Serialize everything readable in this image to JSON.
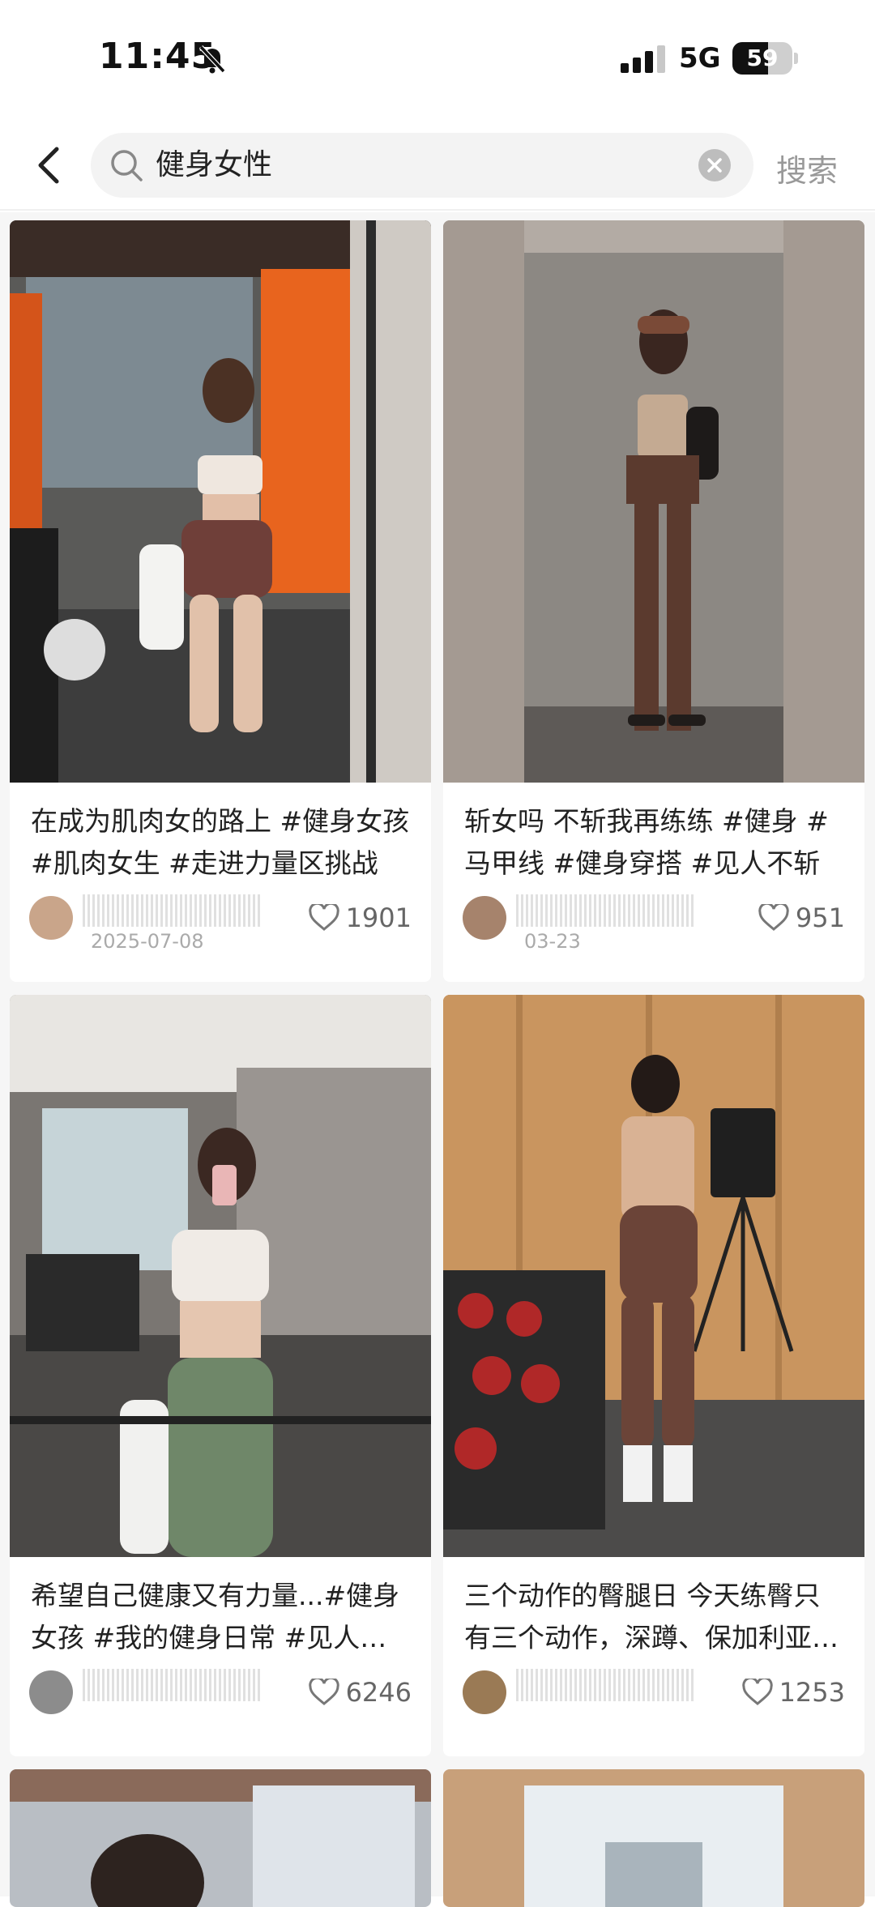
{
  "status_bar": {
    "time": "11:45",
    "network": "5G",
    "battery": "59",
    "battery_level": 0.59
  },
  "search": {
    "query": "健身女性",
    "button_label": "搜索"
  },
  "feed": [
    {
      "title": "在成为肌肉女的路上 #健身女孩 #肌肉女生 #走进力量区挑战",
      "date": "2025-07-08",
      "likes": "1901"
    },
    {
      "title": "斩女吗 不斩我再练练 #健身 #马甲线 #健身穿搭 #见人不斩",
      "date": "03-23",
      "likes": "951"
    },
    {
      "title": "希望自己健康又有力量...#健身女孩 #我的健身日常 #见人不斩",
      "date": "",
      "likes": "6246"
    },
    {
      "title": "三个动作的臀腿日 今天练臀只有三个动作，深蹲、保加利亚分腿蹲",
      "date": "",
      "likes": "1253"
    },
    {
      "title": "",
      "date": "",
      "likes": ""
    },
    {
      "title": "",
      "date": "",
      "likes": ""
    }
  ],
  "colors": {
    "accent": "#ff2442",
    "muted": "#999999"
  },
  "icons": [
    "bell-slash-icon",
    "signal-icon",
    "battery-icon",
    "back-icon",
    "search-icon",
    "clear-icon",
    "heart-icon"
  ]
}
